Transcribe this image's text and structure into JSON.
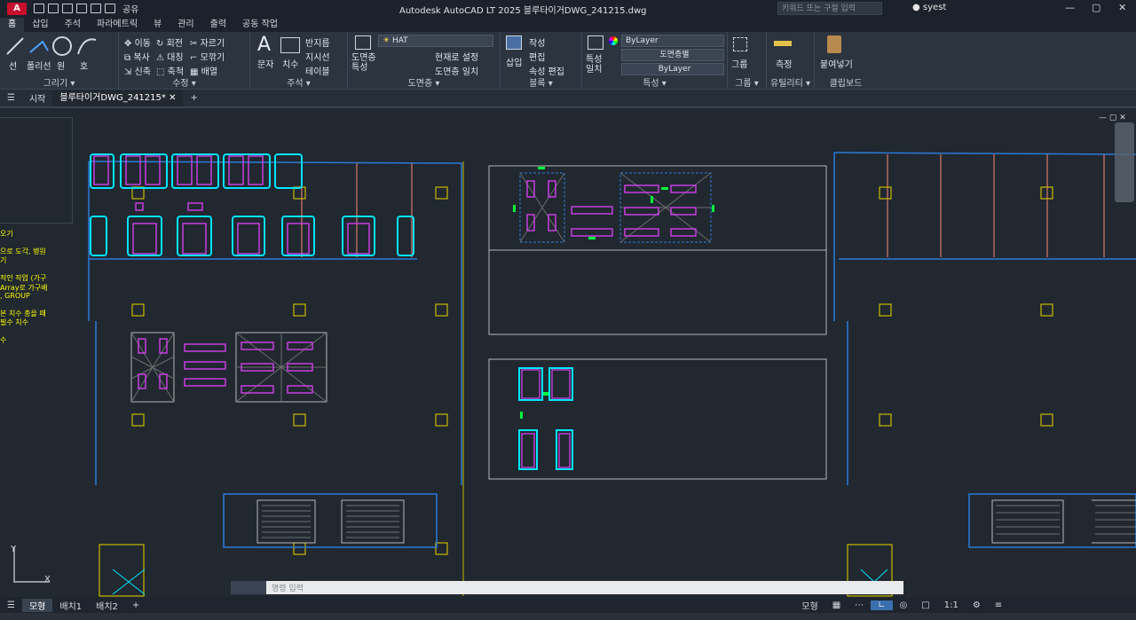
{
  "titlebar": {
    "app_badge": "A",
    "lt_badge": "LT",
    "share": "공유",
    "title": "Autodesk AutoCAD LT 2025    블루타이거DWG_241215.dwg",
    "search_placeholder": "키워드 또는 구절 입력",
    "user": "syest"
  },
  "ribbon_tabs": [
    "홈",
    "삽입",
    "주석",
    "파라메트릭",
    "뷰",
    "관리",
    "출력",
    "공동 작업"
  ],
  "panels": {
    "draw": {
      "label": "그리기 ▾",
      "tools": [
        "선",
        "폴리선",
        "원",
        "호"
      ]
    },
    "modify": {
      "label": "수정 ▾",
      "tools": [
        "이동",
        "회전",
        "자르기",
        "복사",
        "대칭",
        "모깎기",
        "신축",
        "축척",
        "배열"
      ]
    },
    "annotation": {
      "label": "주석 ▾",
      "tools": [
        "문자",
        "치수",
        "반지름",
        "지시선",
        "테이블"
      ]
    },
    "layers": {
      "label": "도면층 ▾",
      "layer_name": "HAT",
      "tools": [
        "도면층 특성",
        "현재로 설정",
        "도면층 일치"
      ]
    },
    "block": {
      "label": "블록 ▾",
      "tools": [
        "삽입",
        "작성",
        "편집",
        "속성 편집"
      ]
    },
    "properties": {
      "label": "특성 ▾",
      "match": "특성 일치",
      "color": "ByLayer",
      "linetype": "도면층별",
      "lineweight": "ByLayer"
    },
    "groups": {
      "label": "그룹 ▾",
      "tool": "그룹"
    },
    "utilities": {
      "label": "유틸리티 ▾",
      "tool": "측정"
    },
    "clipboard": {
      "label": "클립보드",
      "tool": "붙여넣기"
    }
  },
  "doc_tabs": {
    "start": "시작",
    "active": "블루타이거DWG_241215*",
    "add": "+"
  },
  "side_notes": [
    "오기",
    "으로 도각, 병원",
    "기",
    "적인 작업 (가구",
    "Array로 가구배",
    ", GROUP",
    "본 치수 총을 때",
    "필수 치수",
    "수"
  ],
  "axis": {
    "x": "X",
    "y": "Y"
  },
  "cmdline": {
    "placeholder": "명령 입력"
  },
  "layout_tabs": [
    "모형",
    "배치1",
    "배치2"
  ],
  "status": {
    "mode": "모형",
    "scale": "1:1"
  },
  "colors": {
    "cyan": "#00e5ff",
    "magenta": "#e040fb",
    "green": "#00ff3c",
    "blue": "#2a7bd8",
    "yellow": "#c9b900",
    "salmon": "#d87a6b",
    "lightgray": "#b8b8b8"
  }
}
